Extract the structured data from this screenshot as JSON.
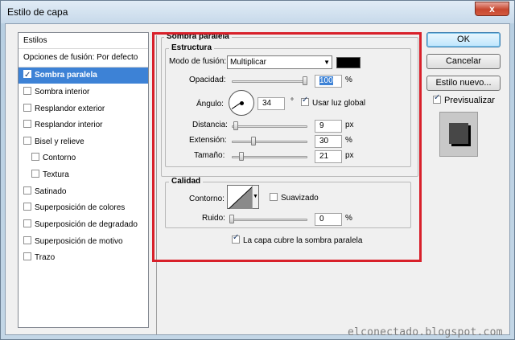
{
  "window": {
    "title": "Estilo de capa",
    "close_glyph": "x"
  },
  "left_panel": {
    "header": "Estilos",
    "blend_options": "Opciones de fusión: Por defecto",
    "items": [
      {
        "label": "Sombra paralela",
        "checked": true,
        "selected": true
      },
      {
        "label": "Sombra interior",
        "checked": false
      },
      {
        "label": "Resplandor exterior",
        "checked": false
      },
      {
        "label": "Resplandor interior",
        "checked": false
      },
      {
        "label": "Bisel y relieve",
        "checked": false
      },
      {
        "label": "Contorno",
        "checked": false,
        "indent": true
      },
      {
        "label": "Textura",
        "checked": false,
        "indent": true
      },
      {
        "label": "Satinado",
        "checked": false
      },
      {
        "label": "Superposición de colores",
        "checked": false
      },
      {
        "label": "Superposición de degradado",
        "checked": false
      },
      {
        "label": "Superposición de motivo",
        "checked": false
      },
      {
        "label": "Trazo",
        "checked": false
      }
    ]
  },
  "drop_shadow": {
    "title": "Sombra paralela",
    "structure": {
      "title": "Estructura",
      "blend_mode_label": "Modo de fusión:",
      "blend_mode_value": "Multiplicar",
      "shadow_color": "#000000",
      "opacity_label": "Opacidad:",
      "opacity_value": "100",
      "opacity_unit": "%",
      "angle_label": "Ángulo:",
      "angle_value": "34",
      "angle_unit": "°",
      "global_light_label": "Usar luz global",
      "global_light_checked": true,
      "distance_label": "Distancia:",
      "distance_value": "9",
      "distance_unit": "px",
      "spread_label": "Extensión:",
      "spread_value": "30",
      "spread_unit": "%",
      "size_label": "Tamaño:",
      "size_value": "21",
      "size_unit": "px"
    },
    "quality": {
      "title": "Calidad",
      "contour_label": "Contorno:",
      "antialias_label": "Suavizado",
      "antialias_checked": false,
      "noise_label": "Ruido:",
      "noise_value": "0",
      "noise_unit": "%"
    },
    "knockout_label": "La capa cubre la sombra paralela",
    "knockout_checked": true
  },
  "buttons": {
    "ok": "OK",
    "cancel": "Cancelar",
    "new_style": "Estilo nuevo...",
    "preview_label": "Previsualizar",
    "preview_checked": true
  },
  "colors": {
    "selection": "#3d82d6",
    "highlight_frame": "#d8202a"
  },
  "watermark": "elconectado.blogspot.com"
}
